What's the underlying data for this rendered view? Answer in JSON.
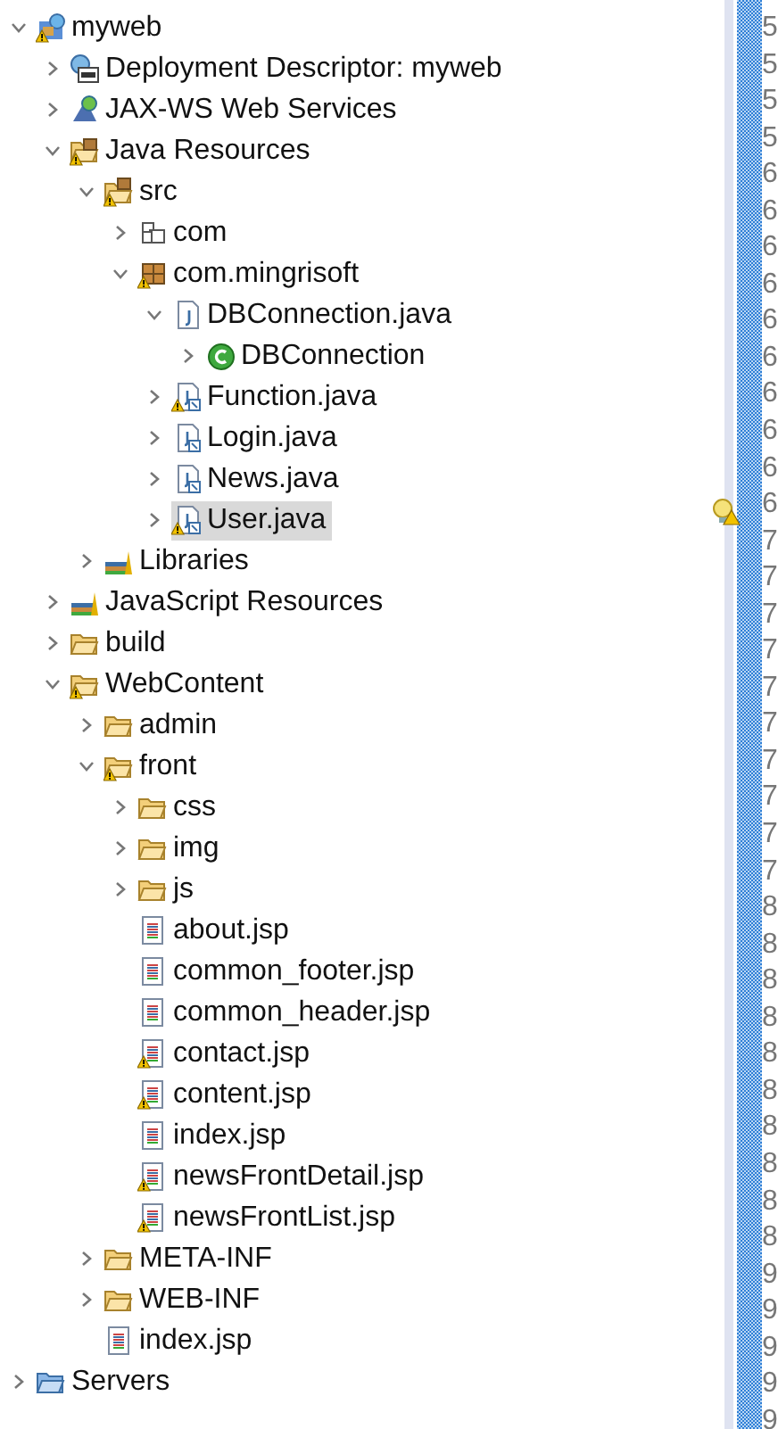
{
  "tree": [
    {
      "label": "myweb",
      "kind": "project",
      "warning": true,
      "expanded": true,
      "selected": false,
      "children": [
        {
          "label": "Deployment Descriptor: myweb",
          "kind": "descriptor",
          "warning": false,
          "expanded": false,
          "selected": false
        },
        {
          "label": "JAX-WS Web Services",
          "kind": "webservice",
          "warning": false,
          "expanded": false,
          "selected": false
        },
        {
          "label": "Java Resources",
          "kind": "resources",
          "warning": true,
          "expanded": true,
          "selected": false,
          "children": [
            {
              "label": "src",
              "kind": "srcfolder",
              "warning": true,
              "expanded": true,
              "selected": false,
              "children": [
                {
                  "label": "com",
                  "kind": "package_empty",
                  "warning": false,
                  "expanded": false,
                  "selected": false
                },
                {
                  "label": "com.mingrisoft",
                  "kind": "package",
                  "warning": true,
                  "expanded": true,
                  "selected": false,
                  "children": [
                    {
                      "label": "DBConnection.java",
                      "kind": "javafile",
                      "warning": false,
                      "expanded": true,
                      "selected": false,
                      "children": [
                        {
                          "label": "DBConnection",
                          "kind": "class",
                          "warning": false,
                          "expanded": false,
                          "selected": false
                        }
                      ]
                    },
                    {
                      "label": "Function.java",
                      "kind": "javafile_linked",
                      "warning": true,
                      "expanded": false,
                      "selected": false
                    },
                    {
                      "label": "Login.java",
                      "kind": "javafile_linked",
                      "warning": false,
                      "expanded": false,
                      "selected": false
                    },
                    {
                      "label": "News.java",
                      "kind": "javafile_linked",
                      "warning": false,
                      "expanded": false,
                      "selected": false
                    },
                    {
                      "label": "User.java",
                      "kind": "javafile_linked",
                      "warning": true,
                      "expanded": false,
                      "selected": true
                    }
                  ]
                }
              ]
            },
            {
              "label": "Libraries",
              "kind": "library",
              "warning": false,
              "expanded": false,
              "selected": false
            }
          ]
        },
        {
          "label": "JavaScript Resources",
          "kind": "library",
          "warning": false,
          "expanded": false,
          "selected": false
        },
        {
          "label": "build",
          "kind": "folder",
          "warning": false,
          "expanded": false,
          "selected": false
        },
        {
          "label": "WebContent",
          "kind": "folder",
          "warning": true,
          "expanded": true,
          "selected": false,
          "children": [
            {
              "label": "admin",
              "kind": "folder",
              "warning": false,
              "expanded": false,
              "selected": false
            },
            {
              "label": "front",
              "kind": "folder",
              "warning": true,
              "expanded": true,
              "selected": false,
              "children": [
                {
                  "label": "css",
                  "kind": "folder",
                  "warning": false,
                  "expanded": false,
                  "selected": false
                },
                {
                  "label": "img",
                  "kind": "folder",
                  "warning": false,
                  "expanded": false,
                  "selected": false
                },
                {
                  "label": "js",
                  "kind": "folder",
                  "warning": false,
                  "expanded": false,
                  "selected": false
                },
                {
                  "label": "about.jsp",
                  "kind": "jsp",
                  "warning": false,
                  "selected": false
                },
                {
                  "label": "common_footer.jsp",
                  "kind": "jsp",
                  "warning": false,
                  "selected": false
                },
                {
                  "label": "common_header.jsp",
                  "kind": "jsp",
                  "warning": false,
                  "selected": false
                },
                {
                  "label": "contact.jsp",
                  "kind": "jsp",
                  "warning": true,
                  "selected": false
                },
                {
                  "label": "content.jsp",
                  "kind": "jsp",
                  "warning": true,
                  "selected": false
                },
                {
                  "label": "index.jsp",
                  "kind": "jsp",
                  "warning": false,
                  "selected": false
                },
                {
                  "label": "newsFrontDetail.jsp",
                  "kind": "jsp",
                  "warning": true,
                  "selected": false
                },
                {
                  "label": "newsFrontList.jsp",
                  "kind": "jsp",
                  "warning": true,
                  "selected": false
                }
              ]
            },
            {
              "label": "META-INF",
              "kind": "folder",
              "warning": false,
              "expanded": false,
              "selected": false
            },
            {
              "label": "WEB-INF",
              "kind": "folder",
              "warning": false,
              "expanded": false,
              "selected": false
            },
            {
              "label": "index.jsp",
              "kind": "jsp",
              "warning": false,
              "selected": false
            }
          ]
        }
      ]
    },
    {
      "label": "Servers",
      "kind": "server_folder",
      "warning": false,
      "expanded": false,
      "selected": false
    }
  ],
  "line_numbers": [
    {
      "text": "5",
      "warning": false
    },
    {
      "text": "5",
      "warning": false
    },
    {
      "text": "5",
      "warning": false
    },
    {
      "text": "5",
      "warning": false
    },
    {
      "text": "6",
      "warning": false
    },
    {
      "text": "6",
      "warning": false
    },
    {
      "text": "6",
      "warning": false
    },
    {
      "text": "6",
      "warning": false
    },
    {
      "text": "6",
      "warning": false
    },
    {
      "text": "6",
      "warning": false
    },
    {
      "text": "6",
      "warning": false
    },
    {
      "text": "6",
      "warning": false
    },
    {
      "text": "6",
      "warning": false
    },
    {
      "text": "6",
      "warning": true
    },
    {
      "text": "7",
      "warning": false
    },
    {
      "text": "7",
      "warning": false
    },
    {
      "text": "7",
      "warning": false
    },
    {
      "text": "7",
      "warning": false
    },
    {
      "text": "7",
      "warning": false
    },
    {
      "text": "7",
      "warning": false
    },
    {
      "text": "7",
      "warning": false
    },
    {
      "text": "7",
      "warning": false
    },
    {
      "text": "7",
      "warning": false
    },
    {
      "text": "7",
      "warning": false
    },
    {
      "text": "8",
      "warning": false
    },
    {
      "text": "8",
      "warning": false
    },
    {
      "text": "8",
      "warning": false
    },
    {
      "text": "8",
      "warning": false
    },
    {
      "text": "8",
      "warning": false
    },
    {
      "text": "8",
      "warning": false
    },
    {
      "text": "8",
      "warning": false
    },
    {
      "text": "8",
      "warning": false
    },
    {
      "text": "8",
      "warning": false
    },
    {
      "text": "8",
      "warning": false
    },
    {
      "text": "9",
      "warning": false
    },
    {
      "text": "9",
      "warning": false
    },
    {
      "text": "9",
      "warning": false
    },
    {
      "text": "9",
      "warning": false
    },
    {
      "text": "9",
      "warning": false
    }
  ]
}
